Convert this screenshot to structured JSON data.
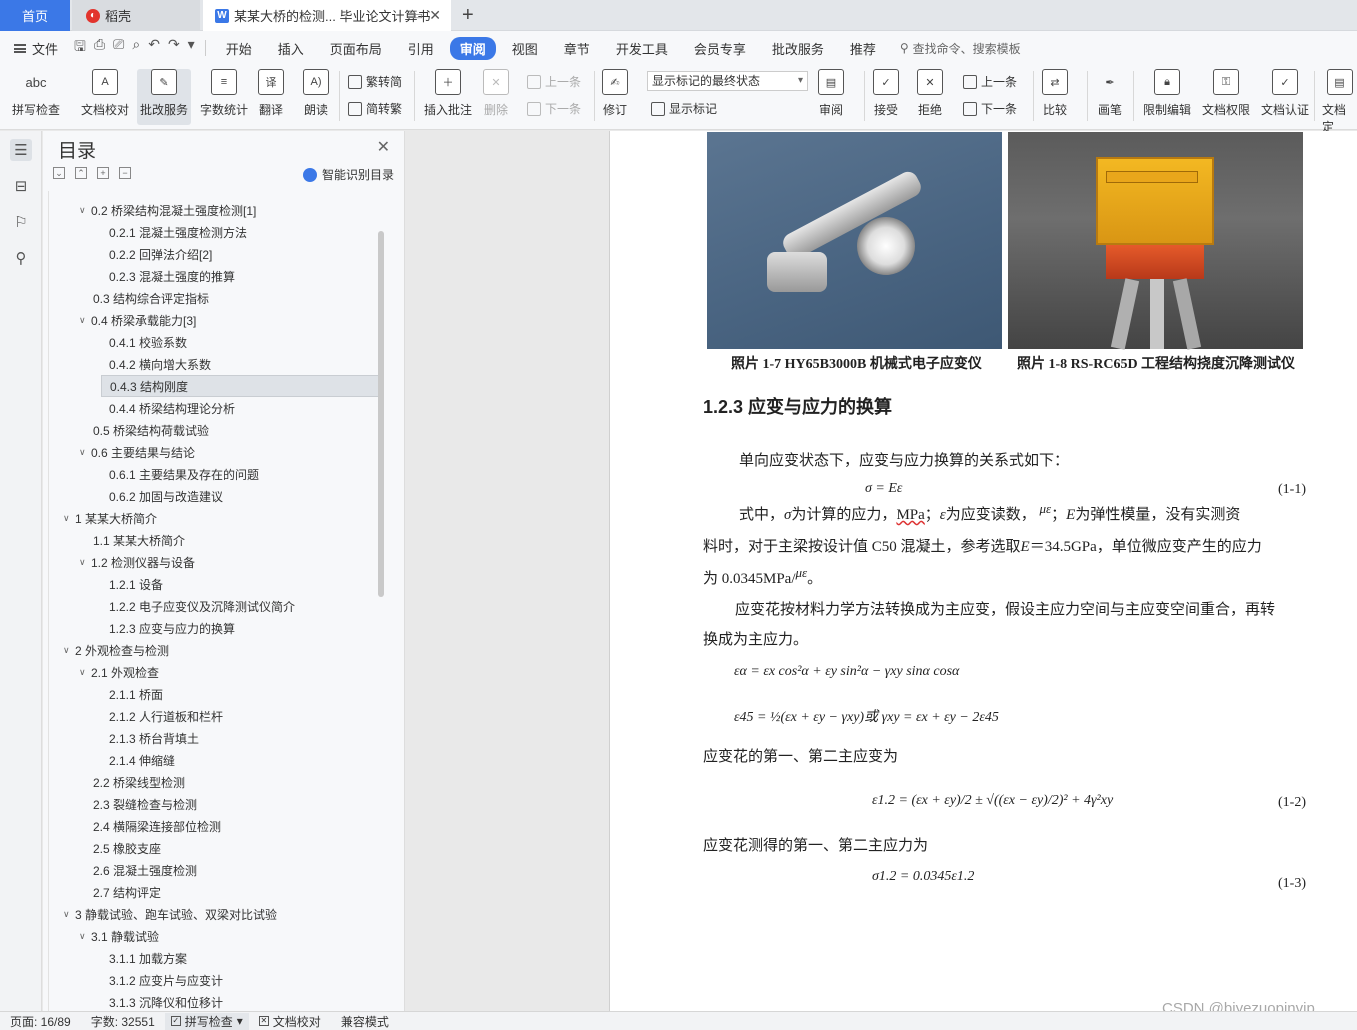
{
  "tabs": {
    "home": "首页",
    "daoke": "稻壳",
    "doc": "某某大桥的检测... 毕业论文计算书"
  },
  "menubar": {
    "file": "文件",
    "items": [
      "开始",
      "插入",
      "页面布局",
      "引用",
      "审阅",
      "视图",
      "章节",
      "开发工具",
      "会员专享",
      "批改服务",
      "推荐"
    ],
    "active_index": 4,
    "search": "查找命令、搜索模板"
  },
  "ribbon": {
    "spell_check": "拼写检查",
    "doc_proof": "文档校对",
    "correct_service": "批改服务",
    "word_count": "字数统计",
    "translate": "翻译",
    "read_aloud": "朗读",
    "trad_simp": "繁转简",
    "simp_trad": "简转繁",
    "insert_comment": "插入批注",
    "delete": "删除",
    "prev_comment": "上一条",
    "next_comment": "下一条",
    "revise": "修订",
    "markup_state": "显示标记的最终状态",
    "show_markup": "显示标记",
    "review": "审阅",
    "accept": "接受",
    "reject": "拒绝",
    "prev_change": "上一条",
    "next_change": "下一条",
    "compare": "比较",
    "pen": "画笔",
    "restrict_edit": "限制编辑",
    "doc_permission": "文档权限",
    "doc_cert": "文档认证",
    "doc_final": "文档定"
  },
  "toc": {
    "title": "目录",
    "smart": "智能识别目录",
    "items": [
      {
        "caret": "∨",
        "text": "0.2 桥梁结构混凝土强度检测[1]",
        "level": 2
      },
      {
        "caret": "",
        "text": "0.2.1  混凝土强度检测方法",
        "level": 3
      },
      {
        "caret": "",
        "text": "0.2.2  回弹法介绍[2]",
        "level": 3
      },
      {
        "caret": "",
        "text": "0.2.3  混凝土强度的推算",
        "level": 3
      },
      {
        "caret": "",
        "text": "0.3  结构综合评定指标",
        "level": 2
      },
      {
        "caret": "∨",
        "text": "0.4 桥梁承载能力[3]",
        "level": 2
      },
      {
        "caret": "",
        "text": "0.4.1  校验系数",
        "level": 3
      },
      {
        "caret": "",
        "text": "0.4.2  横向增大系数",
        "level": 3
      },
      {
        "caret": "",
        "text": "0.4.3  结构刚度",
        "level": 3
      },
      {
        "caret": "",
        "text": "0.4.4  桥梁结构理论分析",
        "level": 3
      },
      {
        "caret": "",
        "text": "0.5  桥梁结构荷载试验",
        "level": 2
      },
      {
        "caret": "∨",
        "text": "0.6  主要结果与结论",
        "level": 2
      },
      {
        "caret": "",
        "text": "0.6.1  主要结果及存在的问题",
        "level": 3
      },
      {
        "caret": "",
        "text": "0.6.2  加固与改造建议",
        "level": 3
      },
      {
        "caret": "∨",
        "text": "1 某某大桥简介",
        "level": 1
      },
      {
        "caret": "",
        "text": "1.1 某某大桥简介",
        "level": 2
      },
      {
        "caret": "∨",
        "text": "1.2  检测仪器与设备",
        "level": 2
      },
      {
        "caret": "",
        "text": "1.2.1 设备",
        "level": 3
      },
      {
        "caret": "",
        "text": "1.2.2 电子应变仪及沉降测试仪简介",
        "level": 3
      },
      {
        "caret": "",
        "text": "1.2.3  应变与应力的换算",
        "level": 3
      },
      {
        "caret": "∨",
        "text": "2  外观检查与检测",
        "level": 1
      },
      {
        "caret": "∨",
        "text": "2.1 外观检查",
        "level": 2
      },
      {
        "caret": "",
        "text": "2.1.1 桥面",
        "level": 3
      },
      {
        "caret": "",
        "text": "2.1.2 人行道板和栏杆",
        "level": 3
      },
      {
        "caret": "",
        "text": "2.1.3 桥台背填土",
        "level": 3
      },
      {
        "caret": "",
        "text": "2.1.4 伸缩缝",
        "level": 3
      },
      {
        "caret": "",
        "text": "2.2  桥梁线型检测",
        "level": 2
      },
      {
        "caret": "",
        "text": "2.3  裂缝检查与检测",
        "level": 2
      },
      {
        "caret": "",
        "text": "2.4  横隔梁连接部位检测",
        "level": 2
      },
      {
        "caret": "",
        "text": "2.5  橡胶支座",
        "level": 2
      },
      {
        "caret": "",
        "text": "2.6  混凝土强度检测",
        "level": 2
      },
      {
        "caret": "",
        "text": "2.7  结构评定",
        "level": 2
      },
      {
        "caret": "∨",
        "text": "3  静载试验、跑车试验、双梁对比试验",
        "level": 1
      },
      {
        "caret": "∨",
        "text": "3.1 静载试验",
        "level": 2
      },
      {
        "caret": "",
        "text": "3.1.1 加载方案",
        "level": 3
      },
      {
        "caret": "",
        "text": "3.1.2  应变片与应变计",
        "level": 3
      },
      {
        "caret": "",
        "text": "3.1.3 沉降仪和位移计",
        "level": 3
      }
    ],
    "selected_index": 8
  },
  "document": {
    "caption1": "照片 1-7 HY65B3000B 机械式电子应变仪",
    "caption2": "照片 1-8 RS-RC65D 工程结构挠度沉降测试仪",
    "heading": "1.2.3  应变与应力的换算",
    "p1": "单向应变状态下，应变与应力换算的关系式如下：",
    "f1": "σ = Eε",
    "eq1": "(1-1)",
    "p2a": "式中，",
    "p2b": "σ",
    "p2c": "为计算的应力，",
    "p2d": "MPa",
    "p2e": "；",
    "p2f": "ε",
    "p2g": "为应变读数，",
    "p2h": "με",
    "p2i": "；",
    "p2j": "E",
    "p2k": "为弹性模量，没有实测资",
    "p3": "料时，对于主梁按设计值 C50 混凝土，参考选取",
    "p3b": "E",
    "p3c": "＝34.5GPa，单位微应变产生的应力",
    "p4": "为 0.0345MPa/",
    "p4b": "με",
    "p4c": "。",
    "p5": "应变花按材料力学方法转换成为主应变，假设主应力空间与主应变空间重合，再转",
    "p6": "换成为主应力。",
    "f2": "εα = εx cos²α + εy sin²α − γxy sinα cosα",
    "f3": "ε45 = ½(εx + εy − γxy)或 γxy = εx + εy − 2ε45",
    "p7": "应变花的第一、第二主应变为",
    "f4": "ε1.2 = (εx + εy)/2 ± √((εx − εy)/2)² + 4γ²xy",
    "eq2": "(1-2)",
    "p8": "应变花测得的第一、第二主应力为",
    "f5": "σ1.2 = 0.0345ε1.2",
    "eq3": "(1-3)"
  },
  "status": {
    "page": "页面: 16/89",
    "words": "字数: 32551",
    "spell": "拼写检查",
    "proof": "文档校对",
    "compat": "兼容模式"
  },
  "watermark": "CSDN @biyezuopinvip"
}
